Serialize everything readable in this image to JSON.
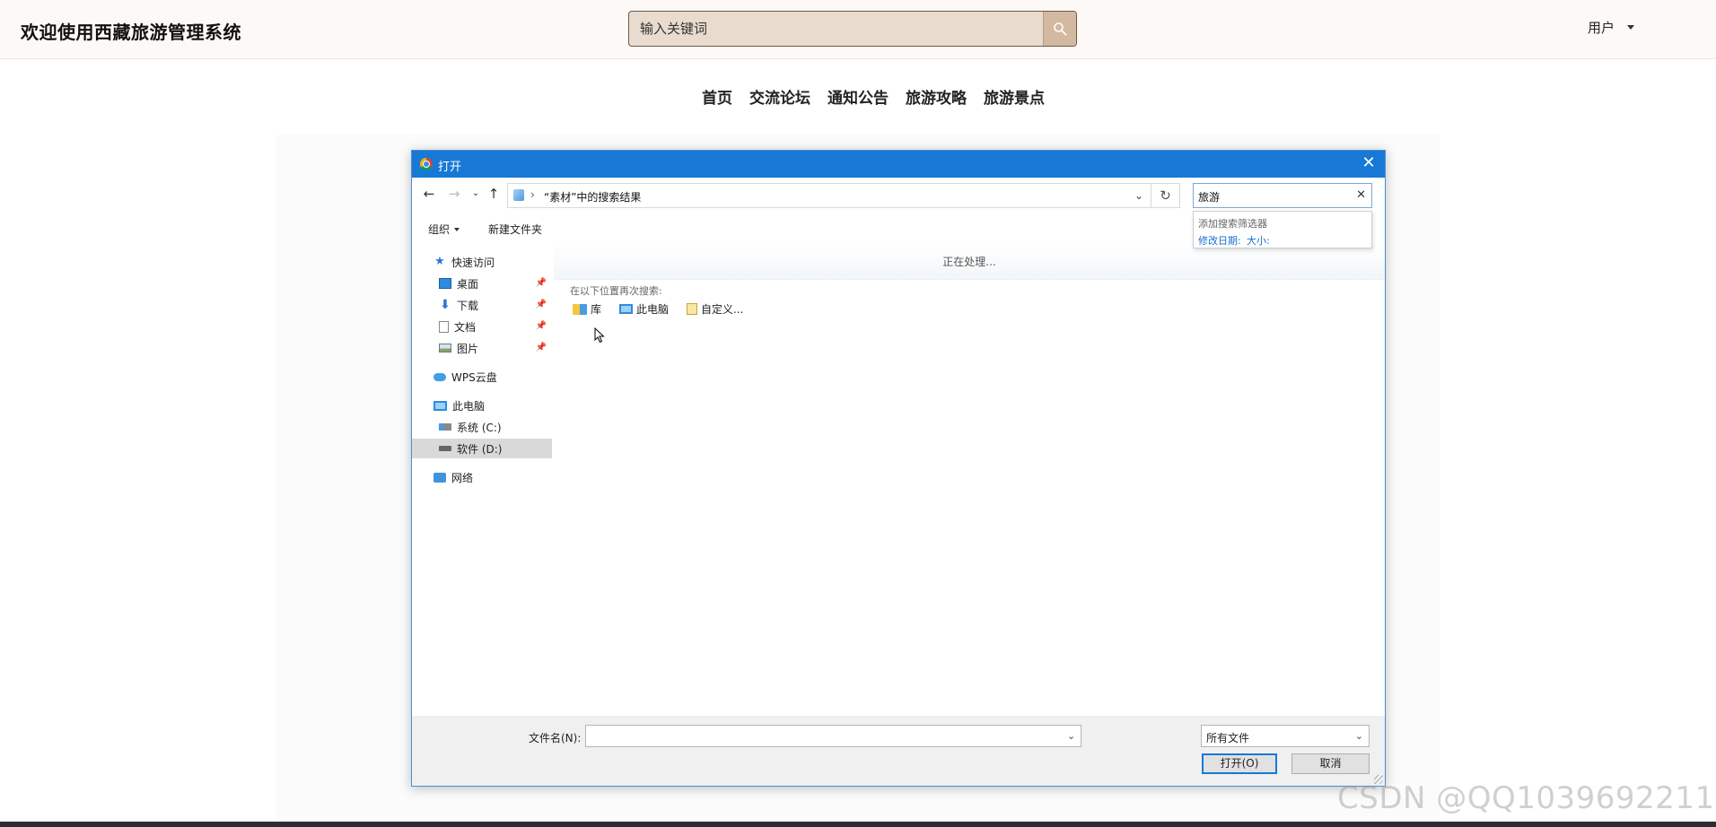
{
  "site": {
    "title": "欢迎使用西藏旅游管理系统",
    "search_placeholder": "输入关键词",
    "user_label": "用户"
  },
  "nav": [
    "首页",
    "交流论坛",
    "通知公告",
    "旅游攻略",
    "旅游景点"
  ],
  "dialog": {
    "title": "打开",
    "address": "“素材”中的搜索结果",
    "search_value": "旅游",
    "filter": {
      "header": "添加搜索筛选器",
      "options": [
        "修改日期:",
        "大小:"
      ]
    },
    "toolbar": {
      "organize": "组织",
      "new_folder": "新建文件夹"
    },
    "sidebar": {
      "quick_access": "快速访问",
      "desktop": "桌面",
      "downloads": "下载",
      "documents": "文档",
      "pictures": "图片",
      "wps_cloud": "WPS云盘",
      "this_pc": "此电脑",
      "drive_c": "系统 (C:)",
      "drive_d": "软件 (D:)",
      "network": "网络"
    },
    "main": {
      "processing": "正在处理...",
      "search_again": "在以下位置再次搜索:",
      "locations": [
        "库",
        "此电脑",
        "自定义..."
      ]
    },
    "footer": {
      "filename_label": "文件名(N):",
      "filename_value": "",
      "filetype": "所有文件",
      "open_button": "打开(O)",
      "cancel_button": "取消"
    }
  },
  "watermark": "CSDN @QQ1039692211",
  "colors": {
    "header_bg": "#fdf9f6",
    "search_bg": "#e9dccf",
    "search_button": "#d3b9a0",
    "dialog_titlebar": "#1779d5",
    "link_blue": "#1a6fd1"
  }
}
